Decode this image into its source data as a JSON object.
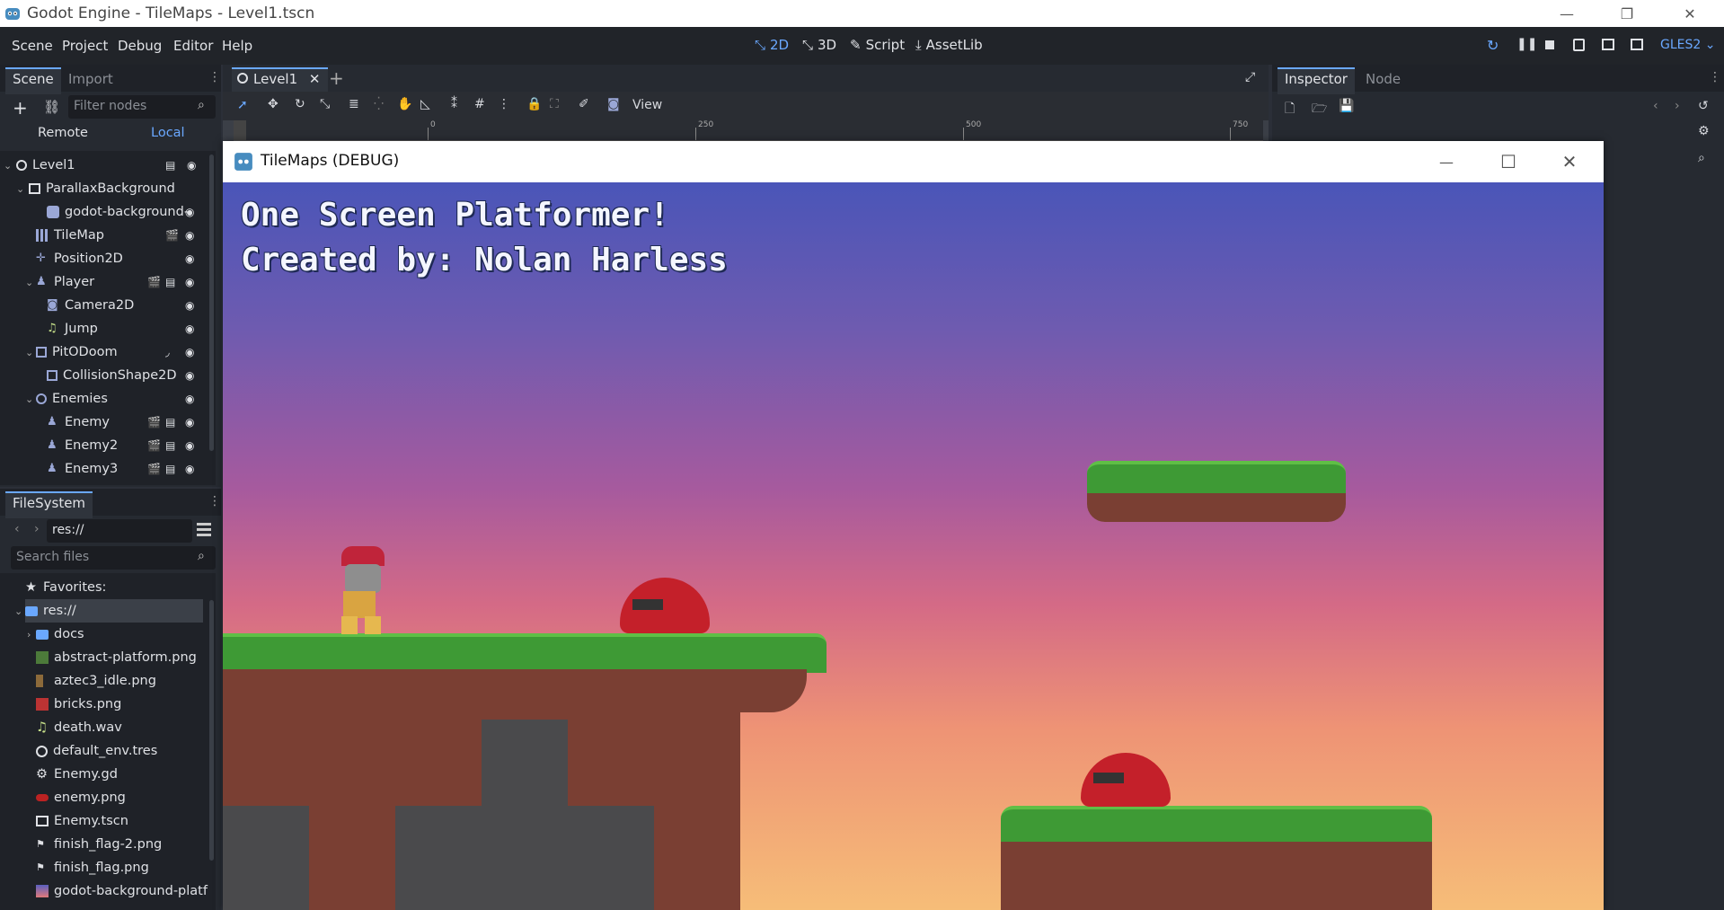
{
  "window": {
    "title": "Godot Engine - TileMaps - Level1.tscn"
  },
  "menu": {
    "items": [
      "Scene",
      "Project",
      "Debug",
      "Editor",
      "Help"
    ]
  },
  "workspaces": {
    "d2": "2D",
    "d3": "3D",
    "script": "Script",
    "assetlib": "AssetLib"
  },
  "renderer": "GLES2",
  "scene_panel": {
    "tab_scene": "Scene",
    "tab_import": "Import",
    "filter_placeholder": "Filter nodes",
    "remote": "Remote",
    "local": "Local",
    "nodes": [
      {
        "label": "Level1"
      },
      {
        "label": "ParallaxBackground"
      },
      {
        "label": "godot-background-"
      },
      {
        "label": "TileMap"
      },
      {
        "label": "Position2D"
      },
      {
        "label": "Player"
      },
      {
        "label": "Camera2D"
      },
      {
        "label": "Jump"
      },
      {
        "label": "PitODoom"
      },
      {
        "label": "CollisionShape2D"
      },
      {
        "label": "Enemies"
      },
      {
        "label": "Enemy"
      },
      {
        "label": "Enemy2"
      },
      {
        "label": "Enemy3"
      }
    ]
  },
  "filesystem": {
    "tab": "FileSystem",
    "path": "res://",
    "search_placeholder": "Search files",
    "favorites": "Favorites:",
    "root": "res://",
    "files": [
      "docs",
      "abstract-platform.png",
      "aztec3_idle.png",
      "bricks.png",
      "death.wav",
      "default_env.tres",
      "Enemy.gd",
      "enemy.png",
      "Enemy.tscn",
      "finish_flag-2.png",
      "finish_flag.png",
      "godot-background-platf"
    ]
  },
  "editor": {
    "scene_tab": "Level1",
    "view_menu": "View",
    "ruler": [
      "0",
      "250",
      "500",
      "750"
    ]
  },
  "inspector": {
    "tab_inspector": "Inspector",
    "tab_node": "Node"
  },
  "debug_window": {
    "title": "TileMaps (DEBUG)",
    "line1": "One Screen Platformer!",
    "line2": "Created by: Nolan Harless"
  }
}
